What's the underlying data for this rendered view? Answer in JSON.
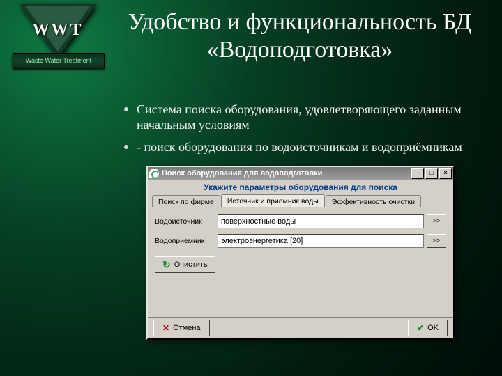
{
  "logo": {
    "text": "WWT",
    "bar": "Waste Water Treatment"
  },
  "slide": {
    "title": "Удобство и функциональность БД «Водоподготовка»",
    "bullets": [
      "Система поиска оборудования, удовлетворяющего заданным начальным условиям",
      "- поиск  оборудования по водоисточникам и водоприёмникам"
    ]
  },
  "dialog": {
    "title": "Поиск оборудования для водоподготовки",
    "subtitle": "Укажите параметры оборудования для поиска",
    "winbtns": {
      "min": "_",
      "max": "□",
      "close": "×"
    },
    "tabs": [
      "Поиск по фирме",
      "Источник и приемник воды",
      "Эффективность очистки"
    ],
    "active_tab": 1,
    "rows": [
      {
        "label": "Водоисточник",
        "value": "поверхностные воды",
        "btn": ">>"
      },
      {
        "label": "Водоприемник",
        "value": "электроэнергетика [20]",
        "btn": ">>"
      }
    ],
    "clear": "Очистить",
    "cancel": "Отмена",
    "ok": "OK"
  }
}
